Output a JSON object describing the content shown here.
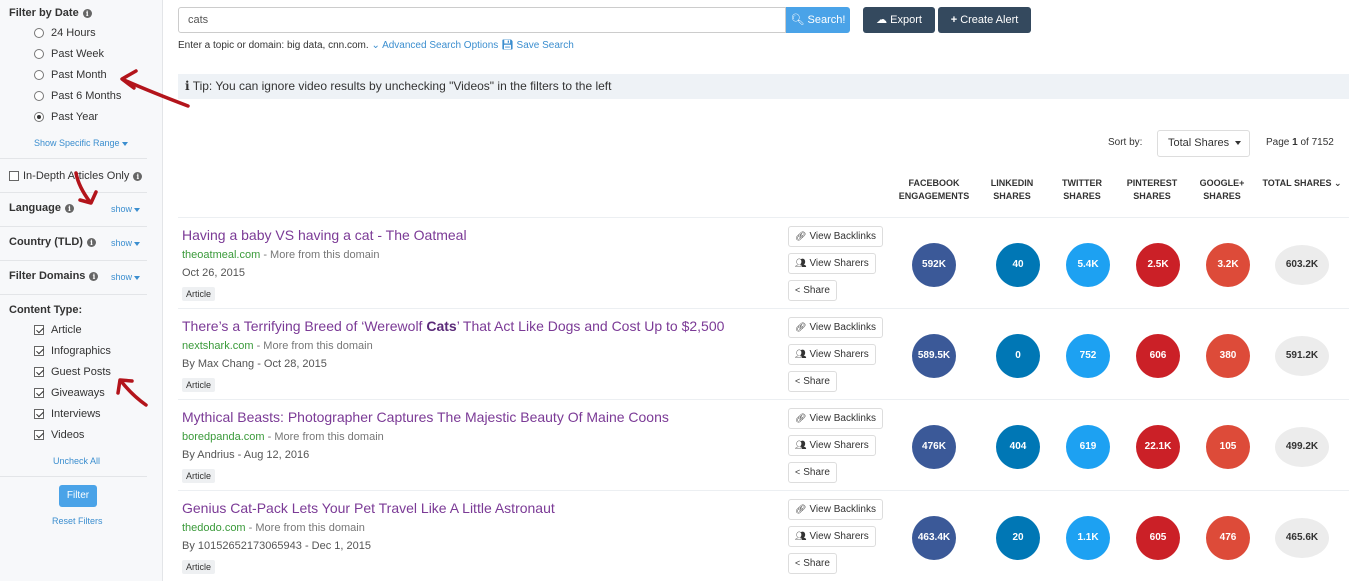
{
  "sidebar": {
    "date_title": "Filter by Date",
    "date_options": [
      {
        "label": "24 Hours",
        "selected": false
      },
      {
        "label": "Past Week",
        "selected": false
      },
      {
        "label": "Past Month",
        "selected": false
      },
      {
        "label": "Past 6 Months",
        "selected": false
      },
      {
        "label": "Past Year",
        "selected": true
      }
    ],
    "show_range": "Show Specific Range",
    "in_depth": "In-Depth Articles Only",
    "language": "Language",
    "country": "Country (TLD)",
    "domains": "Filter Domains",
    "show": "show",
    "content_type_title": "Content Type:",
    "content_types": [
      "Article",
      "Infographics",
      "Guest Posts",
      "Giveaways",
      "Interviews",
      "Videos"
    ],
    "uncheck_all": "Uncheck All",
    "filter_button": "Filter",
    "reset_filters": "Reset Filters"
  },
  "search": {
    "query": "cats",
    "button": "Search!",
    "export": "Export",
    "create_alert": "Create Alert",
    "hint_text": "Enter a topic or domain: big data, cnn.com.",
    "advanced": "Advanced Search Options",
    "save": "Save Search"
  },
  "tip": "Tip: You can ignore video results by unchecking \"Videos\" in the filters to the left",
  "sort": {
    "label": "Sort by:",
    "value": "Total Shares",
    "page_prefix": "Page",
    "page_current": "1",
    "page_of": "of 7152"
  },
  "columns": [
    {
      "line1": "FACEBOOK",
      "line2": "ENGAGEMENTS"
    },
    {
      "line1": "LINKEDIN",
      "line2": "SHARES"
    },
    {
      "line1": "TWITTER",
      "line2": "SHARES"
    },
    {
      "line1": "PINTEREST",
      "line2": "SHARES"
    },
    {
      "line1": "GOOGLE+",
      "line2": "SHARES"
    },
    {
      "line1": "TOTAL SHARES",
      "line2": ""
    }
  ],
  "actions": {
    "backlinks": "View Backlinks",
    "sharers": "View Sharers",
    "share": "Share"
  },
  "results": [
    {
      "title_pre": "Having a baby VS having a cat - The Oatmeal",
      "title_bold": "",
      "title_post": "",
      "domain": "theoatmeal.com",
      "more": " - More from this domain",
      "meta": "Oct 26, 2015",
      "tag": "Article",
      "fb": "592K",
      "li": "40",
      "tw": "5.4K",
      "pi": "2.5K",
      "gp": "3.2K",
      "total": "603.2K"
    },
    {
      "title_pre": "There’s a Terrifying Breed of ‘Werewolf ",
      "title_bold": "Cats",
      "title_post": "’ That Act Like Dogs and Cost Up to $2,500",
      "domain": "nextshark.com",
      "more": " - More from this domain",
      "meta": "By Max Chang - Oct 28, 2015",
      "tag": "Article",
      "fb": "589.5K",
      "li": "0",
      "tw": "752",
      "pi": "606",
      "gp": "380",
      "total": "591.2K"
    },
    {
      "title_pre": "Mythical Beasts: Photographer Captures The Majestic Beauty Of Maine Coons",
      "title_bold": "",
      "title_post": "",
      "domain": "boredpanda.com",
      "more": " - More from this domain",
      "meta": "By Andrius - Aug 12, 2016",
      "tag": "Article",
      "fb": "476K",
      "li": "404",
      "tw": "619",
      "pi": "22.1K",
      "gp": "105",
      "total": "499.2K"
    },
    {
      "title_pre": "Genius Cat-Pack Lets Your Pet Travel Like A Little Astronaut",
      "title_bold": "",
      "title_post": "",
      "domain": "thedodo.com",
      "more": " - More from this domain",
      "meta": "By 10152652173065943 - Dec 1, 2015",
      "tag": "Article",
      "fb": "463.4K",
      "li": "20",
      "tw": "1.1K",
      "pi": "605",
      "gp": "476",
      "total": "465.6K"
    }
  ],
  "colors": {
    "facebook": "#3b5998",
    "linkedin": "#0077b5",
    "twitter": "#1da1f2",
    "pinterest": "#cb2027",
    "googleplus": "#dd4b39",
    "accent": "#4aa3e8",
    "dark_button": "#34495e",
    "annotation_arrow": "#b3141b"
  }
}
